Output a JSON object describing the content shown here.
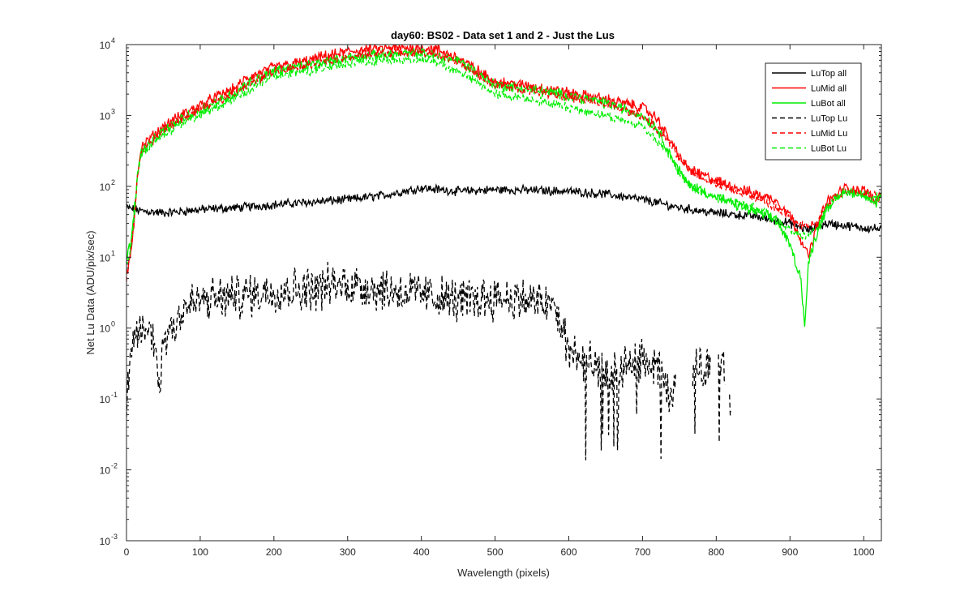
{
  "chart_data": {
    "type": "line",
    "title": "day60: BS02 - Data set 1 and 2 - Just the Lus",
    "xlabel": "Wavelength (pixels)",
    "ylabel": "Net Lu Data (ADU/pix/sec)",
    "xlim": [
      0,
      1024
    ],
    "ylim": [
      0.001,
      10000
    ],
    "yscale": "log",
    "xticks": [
      "0",
      "100",
      "200",
      "300",
      "400",
      "500",
      "600",
      "700",
      "800",
      "900",
      "1000"
    ],
    "yticks": [
      {
        "base": "10",
        "exp": "-3",
        "value": 0.001
      },
      {
        "base": "10",
        "exp": "-2",
        "value": 0.01
      },
      {
        "base": "10",
        "exp": "-1",
        "value": 0.1
      },
      {
        "base": "10",
        "exp": "0",
        "value": 1
      },
      {
        "base": "10",
        "exp": "1",
        "value": 10
      },
      {
        "base": "10",
        "exp": "2",
        "value": 100
      },
      {
        "base": "10",
        "exp": "3",
        "value": 1000
      },
      {
        "base": "10",
        "exp": "4",
        "value": 10000
      }
    ],
    "legend_position": "top-right",
    "grid": false,
    "series": [
      {
        "name": "LuTop  all",
        "color": "#000000",
        "dash": "solid",
        "x": [
          0,
          20,
          50,
          100,
          150,
          200,
          250,
          300,
          350,
          400,
          450,
          500,
          550,
          600,
          650,
          700,
          750,
          800,
          850,
          900,
          925,
          950,
          1000,
          1024
        ],
        "y": [
          50,
          45,
          42,
          47,
          50,
          55,
          60,
          65,
          75,
          95,
          85,
          90,
          88,
          85,
          78,
          65,
          50,
          42,
          38,
          30,
          24,
          30,
          26,
          25
        ]
      },
      {
        "name": "LuMid  all",
        "color": "#ff0000",
        "dash": "solid",
        "x": [
          0,
          5,
          10,
          15,
          20,
          30,
          50,
          80,
          100,
          120,
          150,
          160,
          200,
          250,
          260,
          300,
          350,
          400,
          420,
          450,
          500,
          550,
          600,
          650,
          700,
          720,
          740,
          760,
          800,
          850,
          880,
          900,
          915,
          925,
          935,
          950,
          975,
          990,
          1005,
          1015,
          1024
        ],
        "y": [
          5,
          10,
          30,
          150,
          350,
          450,
          700,
          1100,
          1400,
          1800,
          2500,
          3200,
          4800,
          6000,
          6500,
          8000,
          8800,
          9000,
          8500,
          6500,
          3000,
          2600,
          2100,
          1700,
          1300,
          900,
          400,
          180,
          120,
          80,
          65,
          40,
          18,
          10,
          25,
          60,
          95,
          90,
          85,
          60,
          80
        ]
      },
      {
        "name": "LuBot  all",
        "color": "#00ee00",
        "dash": "solid",
        "x": [
          0,
          5,
          10,
          15,
          20,
          30,
          50,
          80,
          100,
          120,
          150,
          160,
          200,
          250,
          300,
          350,
          400,
          450,
          500,
          550,
          600,
          650,
          700,
          720,
          740,
          760,
          800,
          850,
          880,
          900,
          915,
          920,
          925,
          935,
          950,
          975,
          990,
          1005,
          1015,
          1024
        ],
        "y": [
          10,
          15,
          40,
          150,
          300,
          380,
          600,
          950,
          1200,
          1500,
          2100,
          2700,
          4200,
          5200,
          6500,
          7300,
          7500,
          6000,
          2700,
          2300,
          1900,
          1500,
          1000,
          650,
          250,
          110,
          70,
          45,
          35,
          15,
          5,
          1,
          8,
          20,
          50,
          85,
          80,
          75,
          55,
          75
        ]
      },
      {
        "name": "LuTop  Lu",
        "color": "#000000",
        "dash": "dashed",
        "x": [
          0,
          10,
          20,
          30,
          40,
          45,
          50,
          60,
          80,
          100,
          150,
          200,
          250,
          300,
          350,
          400,
          450,
          500,
          550,
          580,
          590,
          600,
          620,
          650,
          680,
          700,
          720,
          740,
          760,
          790,
          810,
          820
        ],
        "y": [
          0.08,
          0.7,
          1.0,
          0.9,
          0.6,
          0.12,
          0.7,
          1.0,
          2.0,
          2.4,
          2.8,
          3.4,
          3.6,
          4.2,
          3.5,
          3.0,
          2.4,
          2.8,
          2.4,
          2.0,
          1.0,
          0.5,
          0.35,
          0.2,
          0.3,
          0.35,
          0.25,
          0.1,
          0.2,
          0.3,
          0.25,
          0.07
        ]
      },
      {
        "name": "LuMid  Lu",
        "color": "#ff0000",
        "dash": "dashed",
        "x": [
          0,
          5,
          10,
          15,
          20,
          30,
          50,
          80,
          100,
          150,
          200,
          250,
          300,
          350,
          400,
          420,
          450,
          500,
          550,
          600,
          650,
          700,
          730,
          750,
          770,
          800,
          850,
          880,
          900,
          915,
          925,
          935,
          950,
          975,
          1000,
          1024
        ],
        "y": [
          5,
          10,
          30,
          150,
          300,
          400,
          600,
          950,
          1200,
          2200,
          4200,
          5200,
          6800,
          7600,
          7800,
          7400,
          5500,
          2700,
          2300,
          1800,
          1400,
          1000,
          500,
          250,
          150,
          110,
          70,
          50,
          35,
          28,
          28,
          32,
          55,
          90,
          80,
          75
        ]
      },
      {
        "name": "LuBot  Lu",
        "color": "#00ee00",
        "dash": "dashed",
        "x": [
          0,
          5,
          10,
          15,
          20,
          30,
          50,
          80,
          100,
          150,
          200,
          250,
          300,
          350,
          400,
          420,
          450,
          500,
          550,
          600,
          650,
          700,
          730,
          750,
          770,
          800,
          850,
          880,
          900,
          915,
          925,
          935,
          950,
          975,
          1000,
          1024
        ],
        "y": [
          8,
          12,
          35,
          140,
          280,
          360,
          550,
          850,
          1000,
          1800,
          3500,
          4300,
          5400,
          6000,
          6000,
          5600,
          4200,
          2000,
          1700,
          1300,
          1000,
          700,
          350,
          150,
          90,
          70,
          50,
          35,
          25,
          20,
          20,
          25,
          50,
          85,
          75,
          70
        ]
      }
    ]
  }
}
